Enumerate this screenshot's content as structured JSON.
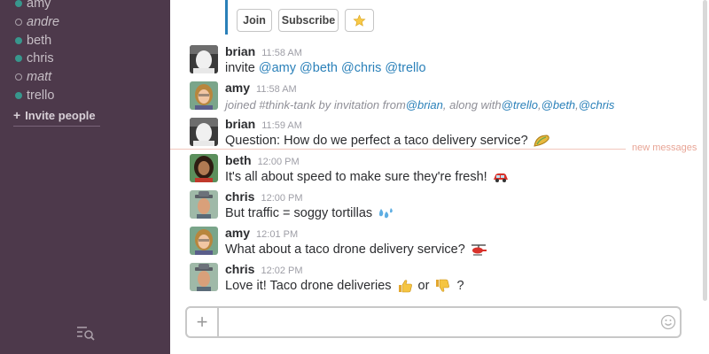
{
  "sidebar": {
    "dms": [
      {
        "name": "amy",
        "status": "online"
      },
      {
        "name": "andre",
        "status": "away"
      },
      {
        "name": "beth",
        "status": "online"
      },
      {
        "name": "chris",
        "status": "online"
      },
      {
        "name": "matt",
        "status": "away"
      },
      {
        "name": "trello",
        "status": "online"
      }
    ],
    "invite_label": "Invite people",
    "invite_plus": "+"
  },
  "attachment": {
    "join_label": "Join",
    "subscribe_label": "Subscribe",
    "star_icon": "star-icon"
  },
  "messages": [
    {
      "author": "brian",
      "time": "11:58 AM",
      "parts": [
        "invite ",
        "@amy",
        " ",
        "@beth",
        " ",
        "@chris",
        " ",
        "@trello"
      ]
    },
    {
      "author": "amy",
      "time": "11:58 AM",
      "parts": [
        "joined #think-tank by invitation from ",
        "@brian",
        ", along with ",
        "@trello",
        ", ",
        "@beth",
        ", ",
        "@chris"
      ]
    },
    {
      "author": "brian",
      "time": "11:59 AM",
      "text": "Question: How do we perfect a taco delivery service?",
      "emoji": "taco-icon"
    },
    {
      "author": "beth",
      "time": "12:00 PM",
      "text": "It's all about speed to make sure they're fresh!",
      "emoji": "car-icon"
    },
    {
      "author": "chris",
      "time": "12:00 PM",
      "text": "But traffic = soggy tortillas",
      "emoji": "sweat-drops-icon"
    },
    {
      "author": "amy",
      "time": "12:01 PM",
      "text": "What about a taco drone delivery service?",
      "emoji": "helicopter-icon"
    },
    {
      "author": "chris",
      "time": "12:02 PM",
      "text1": "Love it! Taco drone deliveries",
      "emoji1": "thumbs-up-icon",
      "text2": "or",
      "emoji2": "thumbs-down-icon",
      "text3": "?"
    }
  ],
  "new_messages_label": "new messages",
  "composer": {
    "plus": "+",
    "placeholder": "",
    "emoji_icon": "smiley-icon"
  },
  "colors": {
    "sidebar_bg": "#4d394b",
    "online": "#38978d",
    "mention": "#2a80b9",
    "new_messages": "#e8a596"
  }
}
